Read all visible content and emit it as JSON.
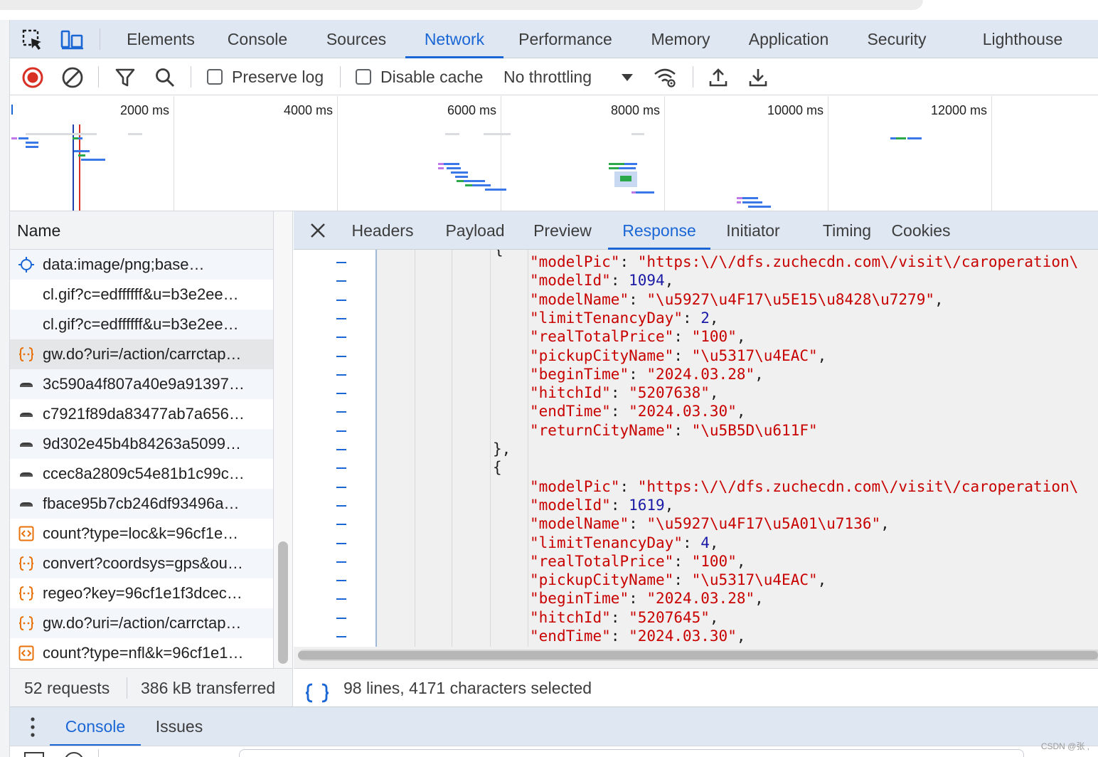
{
  "main_tabs": [
    "Elements",
    "Console",
    "Sources",
    "Network",
    "Performance",
    "Memory",
    "Application",
    "Security",
    "Lighthouse"
  ],
  "active_main_tab": "Network",
  "toolbar": {
    "preserve_log_label": "Preserve log",
    "preserve_log_checked": false,
    "disable_cache_label": "Disable cache",
    "disable_cache_checked": false,
    "throttling_value": "No throttling"
  },
  "overview": {
    "ticks": [
      "2000 ms",
      "4000 ms",
      "6000 ms",
      "8000 ms",
      "10000 ms",
      "12000 ms",
      "1"
    ]
  },
  "requests": {
    "header": "Name",
    "rows": [
      {
        "name": "data:image/png;base…",
        "icon": "image-data-icon"
      },
      {
        "name": "cl.gif?c=edffffff&u=b3e2ee…",
        "icon": "blank-icon"
      },
      {
        "name": "cl.gif?c=edffffff&u=b3e2ee…",
        "icon": "blank-icon"
      },
      {
        "name": "gw.do?uri=/action/carrctap…",
        "icon": "fetch-json-icon"
      },
      {
        "name": "3c590a4f807a40e9a91397…",
        "icon": "car-image-icon"
      },
      {
        "name": "c7921f89da83477ab7a656…",
        "icon": "car-image-icon"
      },
      {
        "name": "9d302e45b4b84263a5099…",
        "icon": "car-image-icon"
      },
      {
        "name": "ccec8a2809c54e81b1c99c…",
        "icon": "car-image-icon"
      },
      {
        "name": "fbace95b7cb246df93496a…",
        "icon": "car-image-icon"
      },
      {
        "name": "count?type=loc&k=96cf1e…",
        "icon": "script-icon"
      },
      {
        "name": "convert?coordsys=gps&ou…",
        "icon": "fetch-json-icon"
      },
      {
        "name": "regeo?key=96cf1e1f3dcec…",
        "icon": "fetch-json-icon"
      },
      {
        "name": "gw.do?uri=/action/carrctap…",
        "icon": "fetch-json-icon"
      },
      {
        "name": "count?type=nfl&k=96cf1e1…",
        "icon": "script-icon"
      }
    ]
  },
  "detail_tabs": [
    "Headers",
    "Payload",
    "Preview",
    "Response",
    "Initiator",
    "Timing",
    "Cookies"
  ],
  "active_detail_tab": "Response",
  "response_lines": [
    {
      "indent": 2,
      "key": "modelPic",
      "value": "\"https:\\/\\/dfs.zuchecdn.com\\/visit\\/caroperation\\",
      "type": "string",
      "comma": ""
    },
    {
      "indent": 2,
      "key": "modelId",
      "value": "1094",
      "type": "number",
      "comma": ","
    },
    {
      "indent": 2,
      "key": "modelName",
      "value": "\"\\u5927\\u4F17\\u5E15\\u8428\\u7279\"",
      "type": "string",
      "comma": ","
    },
    {
      "indent": 2,
      "key": "limitTenancyDay",
      "value": "2",
      "type": "number",
      "comma": ","
    },
    {
      "indent": 2,
      "key": "realTotalPrice",
      "value": "\"100\"",
      "type": "string",
      "comma": ","
    },
    {
      "indent": 2,
      "key": "pickupCityName",
      "value": "\"\\u5317\\u4EAC\"",
      "type": "string",
      "comma": ","
    },
    {
      "indent": 2,
      "key": "beginTime",
      "value": "\"2024.03.28\"",
      "type": "string",
      "comma": ","
    },
    {
      "indent": 2,
      "key": "hitchId",
      "value": "\"5207638\"",
      "type": "string",
      "comma": ","
    },
    {
      "indent": 2,
      "key": "endTime",
      "value": "\"2024.03.30\"",
      "type": "string",
      "comma": ","
    },
    {
      "indent": 2,
      "key": "returnCityName",
      "value": "\"\\u5B5D\\u611F\"",
      "type": "string",
      "comma": ""
    },
    {
      "indent": 1,
      "punct": "},"
    },
    {
      "indent": 1,
      "punct": "{"
    },
    {
      "indent": 2,
      "key": "modelPic",
      "value": "\"https:\\/\\/dfs.zuchecdn.com\\/visit\\/caroperation\\",
      "type": "string",
      "comma": ""
    },
    {
      "indent": 2,
      "key": "modelId",
      "value": "1619",
      "type": "number",
      "comma": ","
    },
    {
      "indent": 2,
      "key": "modelName",
      "value": "\"\\u5927\\u4F17\\u5A01\\u7136\"",
      "type": "string",
      "comma": ","
    },
    {
      "indent": 2,
      "key": "limitTenancyDay",
      "value": "4",
      "type": "number",
      "comma": ","
    },
    {
      "indent": 2,
      "key": "realTotalPrice",
      "value": "\"100\"",
      "type": "string",
      "comma": ","
    },
    {
      "indent": 2,
      "key": "pickupCityName",
      "value": "\"\\u5317\\u4EAC\"",
      "type": "string",
      "comma": ","
    },
    {
      "indent": 2,
      "key": "beginTime",
      "value": "\"2024.03.28\"",
      "type": "string",
      "comma": ","
    },
    {
      "indent": 2,
      "key": "hitchId",
      "value": "\"5207645\"",
      "type": "string",
      "comma": ","
    },
    {
      "indent": 2,
      "key": "endTime",
      "value": "\"2024.03.30\"",
      "type": "string",
      "comma": ","
    }
  ],
  "status": {
    "requests": "52 requests",
    "transferred": "386 kB transferred",
    "selection": "98 lines, 4171 characters selected"
  },
  "drawer_tabs": [
    "Console",
    "Issues"
  ],
  "active_drawer_tab": "Console",
  "watermark": "CSDN @张 ,",
  "colors": {
    "accent": "#1a66d4",
    "tabbar_bg": "#dfe7f3",
    "record_red": "#d93025",
    "json_key": "#c80000",
    "json_number": "#1a1aa6"
  }
}
